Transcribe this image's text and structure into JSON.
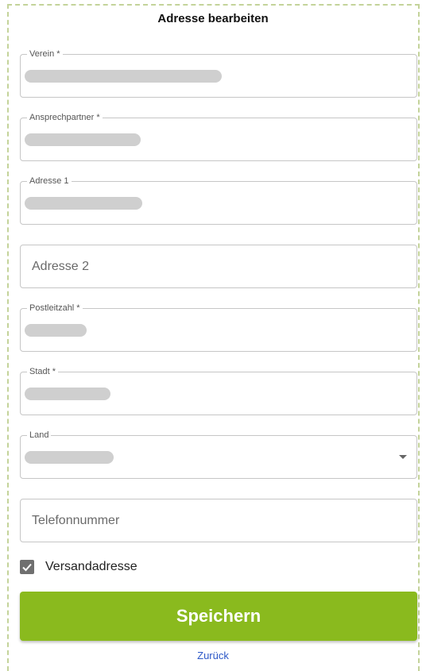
{
  "header": {
    "title": "Adresse bearbeiten"
  },
  "fields": {
    "verein": {
      "label": "Verein *",
      "value_obscured": true
    },
    "ansprechpartner": {
      "label": "Ansprechpartner *",
      "value_obscured": true
    },
    "adresse1": {
      "label": "Adresse 1",
      "value_obscured": true
    },
    "adresse2": {
      "placeholder": "Adresse 2"
    },
    "postleitzahl": {
      "label": "Postleitzahl *",
      "value_obscured": true
    },
    "stadt": {
      "label": "Stadt *",
      "value_obscured": true
    },
    "land": {
      "label": "Land",
      "value_obscured": true
    },
    "telefonnummer": {
      "placeholder": "Telefonnummer"
    }
  },
  "versand": {
    "label": "Versandadresse",
    "checked": true
  },
  "actions": {
    "save_label": "Speichern",
    "back_label": "Zurück"
  },
  "colors": {
    "accent": "#8aba1e",
    "link": "#2b57c7",
    "frame_dash": "#c4d39a"
  }
}
